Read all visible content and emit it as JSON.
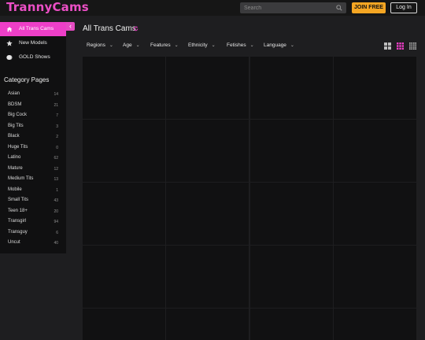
{
  "header": {
    "logo": "TrannyCams",
    "search_placeholder": "Search",
    "join_label": "JOIN FREE",
    "login_label": "Log In"
  },
  "sidebar": {
    "nav": [
      {
        "label": "All Trans Cams",
        "icon": "home-icon",
        "active": true
      },
      {
        "label": "New Models",
        "icon": "star-icon",
        "active": false
      },
      {
        "label": "GOLD Shows",
        "icon": "gold-coin-icon",
        "active": false
      }
    ],
    "category_title": "Category Pages",
    "categories": [
      {
        "name": "Asian",
        "count": "14"
      },
      {
        "name": "BDSM",
        "count": "21"
      },
      {
        "name": "Big Cock",
        "count": "7"
      },
      {
        "name": "Big Tits",
        "count": "3"
      },
      {
        "name": "Black",
        "count": "2"
      },
      {
        "name": "Huge Tits",
        "count": "0"
      },
      {
        "name": "Latino",
        "count": "62"
      },
      {
        "name": "Mature",
        "count": "12"
      },
      {
        "name": "Medium Tits",
        "count": "13"
      },
      {
        "name": "Mobile",
        "count": "1"
      },
      {
        "name": "Small Tits",
        "count": "43"
      },
      {
        "name": "Teen 18+",
        "count": "20"
      },
      {
        "name": "Transgirl",
        "count": "94"
      },
      {
        "name": "Transguy",
        "count": "6"
      },
      {
        "name": "Uncut",
        "count": "40"
      }
    ]
  },
  "main": {
    "title": "All Trans Cams",
    "filters": [
      "Regions",
      "Age",
      "Features",
      "Ethnicity",
      "Fetishes",
      "Language"
    ],
    "views": [
      "large-grid-icon",
      "medium-grid-icon",
      "small-grid-icon"
    ],
    "active_view": "medium-grid-icon"
  },
  "colors": {
    "accent": "#ee3fc8",
    "join_button": "#f5a623",
    "background": "#1e1e20",
    "sidebar": "#101011"
  }
}
